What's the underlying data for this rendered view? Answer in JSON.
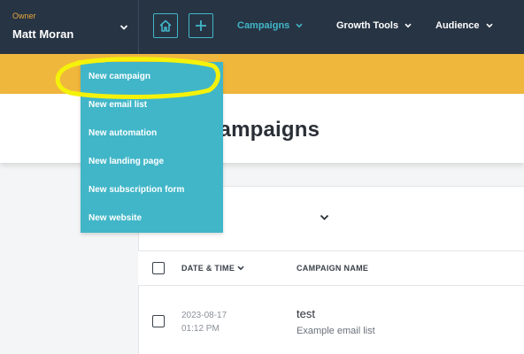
{
  "owner": {
    "label": "Owner",
    "name": "Matt Moran"
  },
  "icons": {
    "home": "home-icon",
    "add": "plus-icon",
    "caret": "chevron-down-icon"
  },
  "nav": {
    "campaigns": "Campaigns",
    "growth_tools": "Growth Tools",
    "audience": "Audience"
  },
  "page": {
    "title": "Campaigns"
  },
  "dropdown": {
    "items": [
      "New campaign",
      "New email list",
      "New automation",
      "New landing page",
      "New subscription form",
      "New website"
    ]
  },
  "table": {
    "columns": {
      "date": "DATE & TIME",
      "name": "CAMPAIGN NAME"
    },
    "rows": [
      {
        "date": "2023-08-17",
        "time": "01:12 PM",
        "name": "test",
        "list": "Example email list"
      }
    ]
  },
  "colors": {
    "nav_bg": "#273444",
    "accent": "#41b6c8",
    "banner": "#f0b73d",
    "owner_label": "#e8a93a",
    "highlight": "#f5f20a"
  }
}
